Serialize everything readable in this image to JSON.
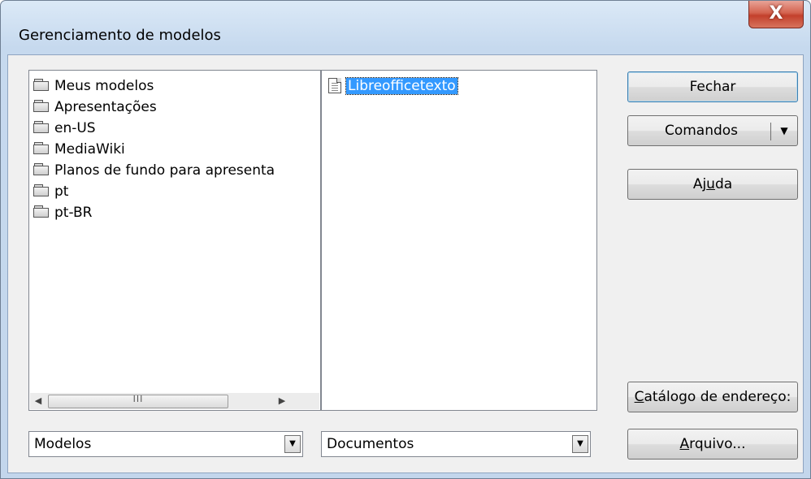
{
  "window": {
    "title": "Gerenciamento de modelos",
    "close_label": "X"
  },
  "left_list": {
    "items": [
      "Meus modelos",
      "Apresentações",
      "en-US",
      "MediaWiki",
      "Planos de fundo para apresenta",
      "pt",
      "pt-BR"
    ],
    "scroll_thumb_grip": "III"
  },
  "right_list": {
    "items": [
      "Libreofficetexto"
    ]
  },
  "buttons": {
    "fechar": "Fechar",
    "comandos": "Comandos",
    "ajuda_pre": "Aj",
    "ajuda_u": "u",
    "ajuda_post": "da",
    "catalogo_u": "C",
    "catalogo_post": "atálogo de endereço:",
    "arquivo_u": "A",
    "arquivo_post": "rquivo..."
  },
  "combos": {
    "left": {
      "value": "Modelos"
    },
    "right": {
      "value": "Documentos"
    }
  },
  "icons": {
    "folder": "folder-icon",
    "document": "document-icon",
    "dropdown": "▼",
    "scroll_left": "◀",
    "scroll_right": "▶"
  },
  "colors": {
    "selection": "#3399ff",
    "close_button": "#c3402c",
    "window_frame": "#c3d6ec"
  }
}
